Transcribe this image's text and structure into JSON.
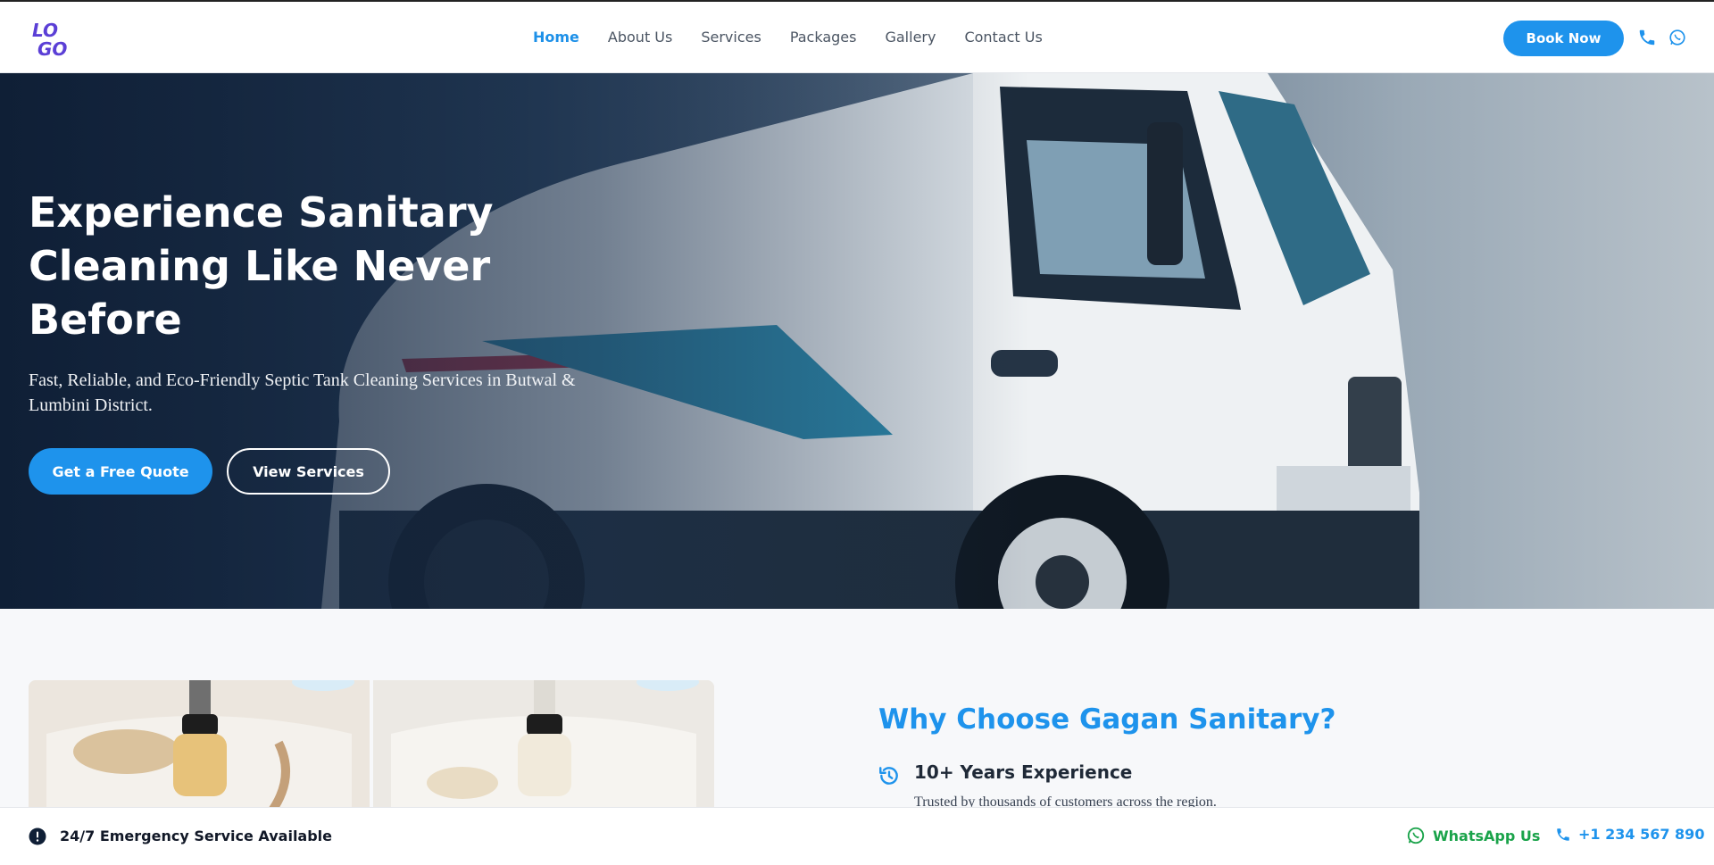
{
  "header": {
    "logo_line1": "LO",
    "logo_line2": "GO",
    "nav": [
      {
        "label": "Home",
        "active": true
      },
      {
        "label": "About Us"
      },
      {
        "label": "Services"
      },
      {
        "label": "Packages"
      },
      {
        "label": "Gallery"
      },
      {
        "label": "Contact Us"
      }
    ],
    "book_label": "Book Now",
    "phone_icon": "phone-icon",
    "whatsapp_icon": "whatsapp-icon"
  },
  "hero": {
    "title": "Experience Sanitary\nCleaning Like Never\nBefore",
    "subtitle": "Fast, Reliable, and Eco-Friendly Septic Tank Cleaning Services in Butwal & Lumbini District.",
    "primary_cta": "Get a Free Quote",
    "secondary_cta": "View Services",
    "image": "white service truck"
  },
  "why": {
    "title": "Why Choose Gagan Sanitary?",
    "features": [
      {
        "icon": "history-icon",
        "title": "10+ Years Experience",
        "description": "Trusted by thousands of customers across the region."
      }
    ]
  },
  "bottom_bar": {
    "emergency_icon": "alert-icon",
    "emergency_text": "24/7 Emergency Service Available",
    "whatsapp_label": "WhatsApp Us",
    "phone_label": "+1 234 567 890"
  },
  "colors": {
    "accent": "#1e93ec",
    "whatsapp": "#1aa34a",
    "hero_dark": "#0f1f36"
  }
}
